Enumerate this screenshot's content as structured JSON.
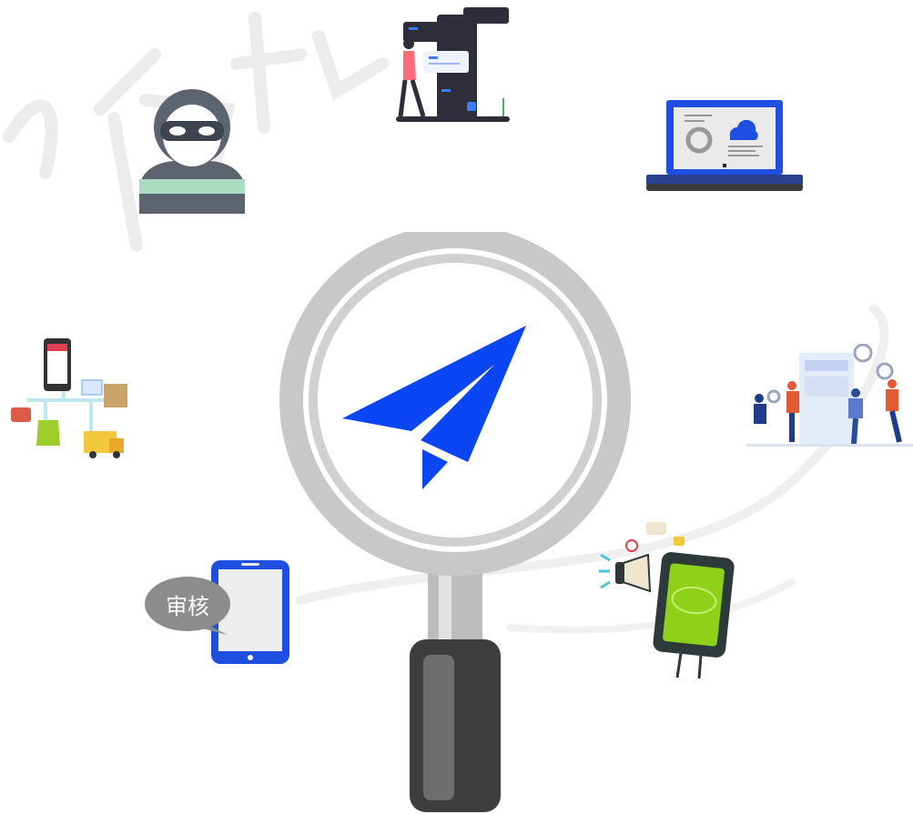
{
  "review_bubble": {
    "label": "审核"
  },
  "watermark": {
    "text": "阿拉"
  },
  "colors": {
    "brand_blue": "#0b46f5",
    "glass_ring": "#c8c8c8",
    "handle": "#3d3d3d",
    "handle_highlight": "#6e6e6e",
    "bubble_grey": "#8c8c8c",
    "phone_green": "#8ed01a"
  },
  "icons": [
    "hacker-icon",
    "chat-screens-illustration",
    "laptop-cloud-settings-icon",
    "ecommerce-flow-illustration",
    "team-building-app-illustration",
    "tablet-review-icon",
    "megaphone-phone-illustration",
    "magnifier-icon",
    "paper-plane-icon"
  ]
}
